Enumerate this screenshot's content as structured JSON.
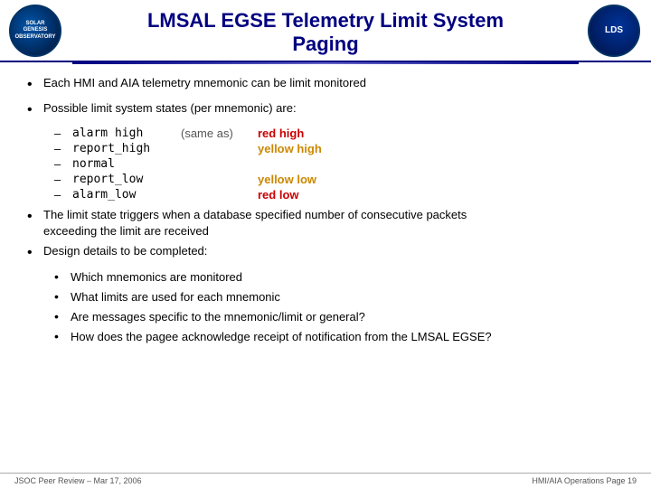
{
  "header": {
    "title_line1": "LMSAL EGSE Telemetry Limit System",
    "title_line2": "Paging",
    "logo_left_text": "SOLAR\nGENESIS\nOBSERVATORY",
    "logo_right_text": "LDS"
  },
  "content": {
    "bullet1": "Each HMI and AIA telemetry mnemonic can be limit monitored",
    "bullet2": "Possible limit system states (per mnemonic) are:",
    "states": [
      {
        "label": "alarm high",
        "same_as": "(same as)",
        "color_label": "red high",
        "color": "red"
      },
      {
        "label": "report_high",
        "same_as": "",
        "color_label": "yellow high",
        "color": "yellow"
      },
      {
        "label": "normal",
        "same_as": "",
        "color_label": "",
        "color": ""
      },
      {
        "label": "report_low",
        "same_as": "",
        "color_label": "yellow low",
        "color": "yellow"
      },
      {
        "label": "alarm_low",
        "same_as": "",
        "color_label": "red low",
        "color": "red"
      }
    ],
    "bullet3_part1": "The limit state triggers when a database specified number of consecutive packets",
    "bullet3_part2": "exceeding the limit are received",
    "bullet4": "Design details to be completed:",
    "sub_bullets": [
      "Which mnemonics are monitored",
      "What limits are used for each mnemonic",
      "Are messages specific to the mnemonic/limit or general?",
      "How does the pagee acknowledge receipt of notification from the LMSAL EGSE?"
    ]
  },
  "footer": {
    "left": "JSOC Peer Review – Mar 17, 2006",
    "right": "HMI/AIA Operations   Page 19"
  }
}
